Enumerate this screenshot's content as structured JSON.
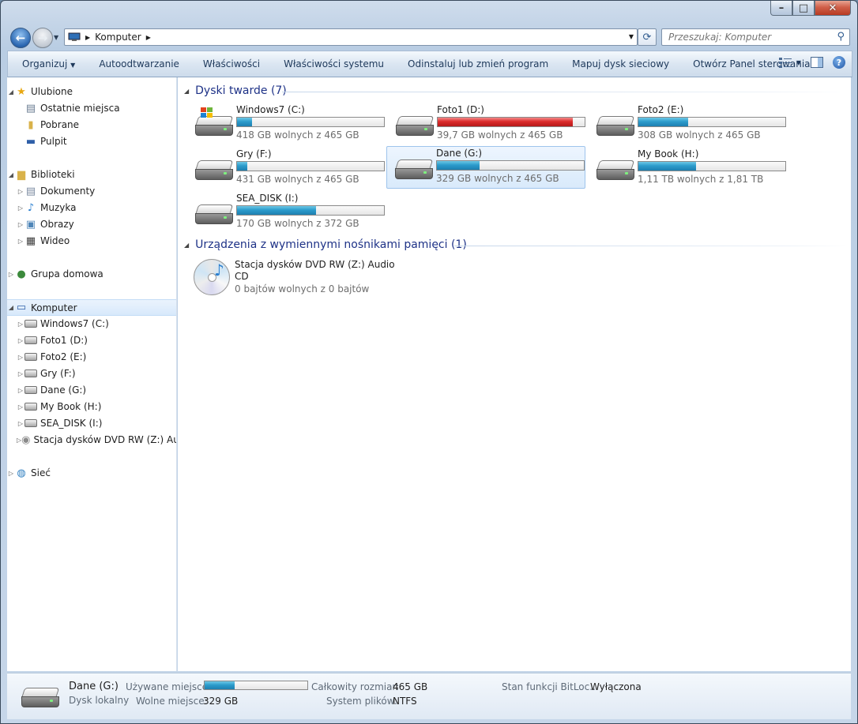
{
  "window": {
    "caption_buttons": {
      "minimize": "–",
      "maximize": "□",
      "close": "✕"
    }
  },
  "address": {
    "path": [
      "Komputer"
    ],
    "search_placeholder": "Przeszukaj: Komputer"
  },
  "toolbar": {
    "items": [
      "Organizuj",
      "Autoodtwarzanie",
      "Właściwości",
      "Właściwości systemu",
      "Odinstaluj lub zmień program",
      "Mapuj dysk sieciowy",
      "Otwórz Panel sterowania"
    ],
    "help_label": "?"
  },
  "nav": {
    "favorites": {
      "label": "Ulubione",
      "items": [
        "Ostatnie miejsca",
        "Pobrane",
        "Pulpit"
      ]
    },
    "libraries": {
      "label": "Biblioteki",
      "items": [
        "Dokumenty",
        "Muzyka",
        "Obrazy",
        "Wideo"
      ]
    },
    "homegroup": "Grupa domowa",
    "computer": {
      "label": "Komputer",
      "items": [
        "Windows7 (C:)",
        "Foto1 (D:)",
        "Foto2 (E:)",
        "Gry (F:)",
        "Dane (G:)",
        "My Book (H:)",
        "SEA_DISK (I:)",
        "Stacja dysków DVD RW (Z:) Audio CD"
      ]
    },
    "network": "Sieć"
  },
  "groups": {
    "hard_drives": "Dyski twarde (7)",
    "removable": "Urządzenia z wymiennymi nośnikami pamięci (1)"
  },
  "drives": [
    {
      "name": "Windows7 (C:)",
      "free": "418 GB wolnych z 465 GB",
      "used_fraction": 0.1,
      "critical": false
    },
    {
      "name": "Foto1 (D:)",
      "free": "39,7 GB wolnych z 465 GB",
      "used_fraction": 0.92,
      "critical": true
    },
    {
      "name": "Foto2 (E:)",
      "free": "308 GB wolnych z 465 GB",
      "used_fraction": 0.34,
      "critical": false
    },
    {
      "name": "Gry (F:)",
      "free": "431 GB wolnych z 465 GB",
      "used_fraction": 0.07,
      "critical": false
    },
    {
      "name": "Dane (G:)",
      "free": "329 GB wolnych z 465 GB",
      "used_fraction": 0.29,
      "critical": false,
      "selected": true
    },
    {
      "name": "My Book (H:)",
      "free": "1,11 TB wolnych z 1,81 TB",
      "used_fraction": 0.39,
      "critical": false
    },
    {
      "name": "SEA_DISK (I:)",
      "free": "170 GB wolnych z 372 GB",
      "used_fraction": 0.54,
      "critical": false
    }
  ],
  "dvd": {
    "name_line1": "Stacja dysków DVD RW (Z:) Audio",
    "name_line2": "CD",
    "free": "0 bajtów wolnych z 0 bajtów"
  },
  "details": {
    "name": "Dane (G:)",
    "type": "Dysk lokalny",
    "used_label": "Używane miejsce:",
    "used_fraction": 0.29,
    "free_label": "Wolne miejsce:",
    "free_value": "329 GB",
    "total_label": "Całkowity rozmiar:",
    "total_value": "465 GB",
    "fs_label": "System plików:",
    "fs_value": "NTFS",
    "bitlocker_label": "Stan funkcji BitLoc...",
    "bitlocker_value": "Wyłączona"
  },
  "colors": {
    "accent": "#1e3287",
    "bar_fill": "#2c9ccc",
    "bar_critical": "#dc2b2b"
  }
}
